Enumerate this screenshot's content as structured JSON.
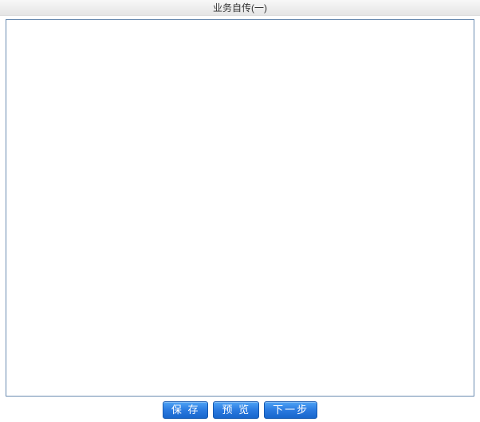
{
  "header": {
    "title": "业务自传(一)"
  },
  "content": {
    "text": ""
  },
  "buttons": {
    "save": "保 存",
    "preview": "预 览",
    "next": "下一步"
  }
}
